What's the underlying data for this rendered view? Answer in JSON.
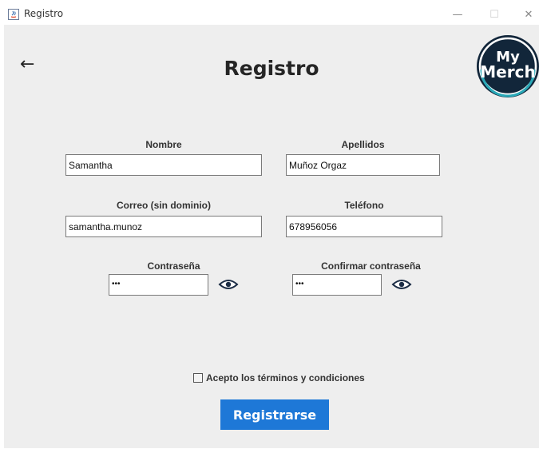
{
  "window": {
    "title": "Registro",
    "minimize": "—",
    "maximize": "☐",
    "close": "✕"
  },
  "header": {
    "back_arrow": "←",
    "title": "Registro",
    "logo_line1": "My",
    "logo_line2": "Merch"
  },
  "form": {
    "nombre": {
      "label": "Nombre",
      "value": "Samantha"
    },
    "apellidos": {
      "label": "Apellidos",
      "value": "Muñoz Orgaz"
    },
    "correo": {
      "label": "Correo (sin dominio)",
      "value": "samantha.munoz"
    },
    "telefono": {
      "label": "Teléfono",
      "value": "678956056"
    },
    "contrasena": {
      "label": "Contraseña",
      "value": "•••"
    },
    "confirmar": {
      "label": "Confirmar contraseña",
      "value": "•••"
    },
    "terms_label": "Acepto los términos y condiciones",
    "terms_checked": false,
    "submit_label": "Registrarse"
  },
  "colors": {
    "accent": "#1e78d7",
    "logo_bg": "#12263a"
  }
}
